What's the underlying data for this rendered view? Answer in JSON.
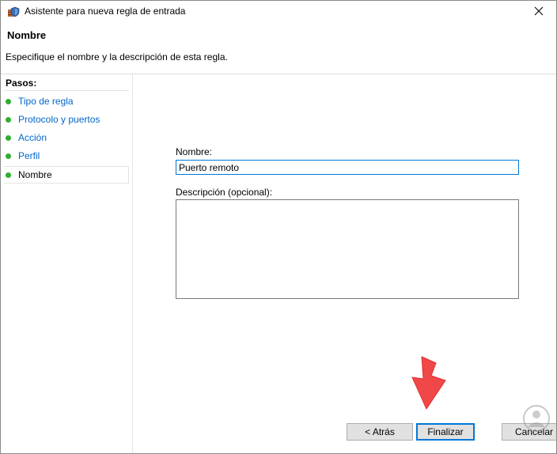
{
  "window": {
    "title": "Asistente para nueva regla de entrada"
  },
  "header": {
    "title": "Nombre",
    "description": "Especifique el nombre y la descripción de esta regla."
  },
  "sidebar": {
    "heading": "Pasos:",
    "steps": [
      {
        "label": "Tipo de regla",
        "status": "completed"
      },
      {
        "label": "Protocolo y puertos",
        "status": "completed"
      },
      {
        "label": "Acción",
        "status": "completed"
      },
      {
        "label": "Perfil",
        "status": "completed"
      },
      {
        "label": "Nombre",
        "status": "current"
      }
    ]
  },
  "form": {
    "name_label": "Nombre:",
    "name_value": "Puerto remoto",
    "description_label": "Descripción (opcional):",
    "description_value": ""
  },
  "buttons": {
    "back": "< Atrás",
    "finish": "Finalizar",
    "cancel": "Cancelar"
  },
  "colors": {
    "accent": "#0078d7",
    "link": "#0066cc",
    "step_dot": "#2fae2f",
    "arrow": "#f04848"
  },
  "icons": {
    "app": "firewall-shield-icon",
    "close": "close-icon",
    "pointer": "red-arrow-icon"
  }
}
